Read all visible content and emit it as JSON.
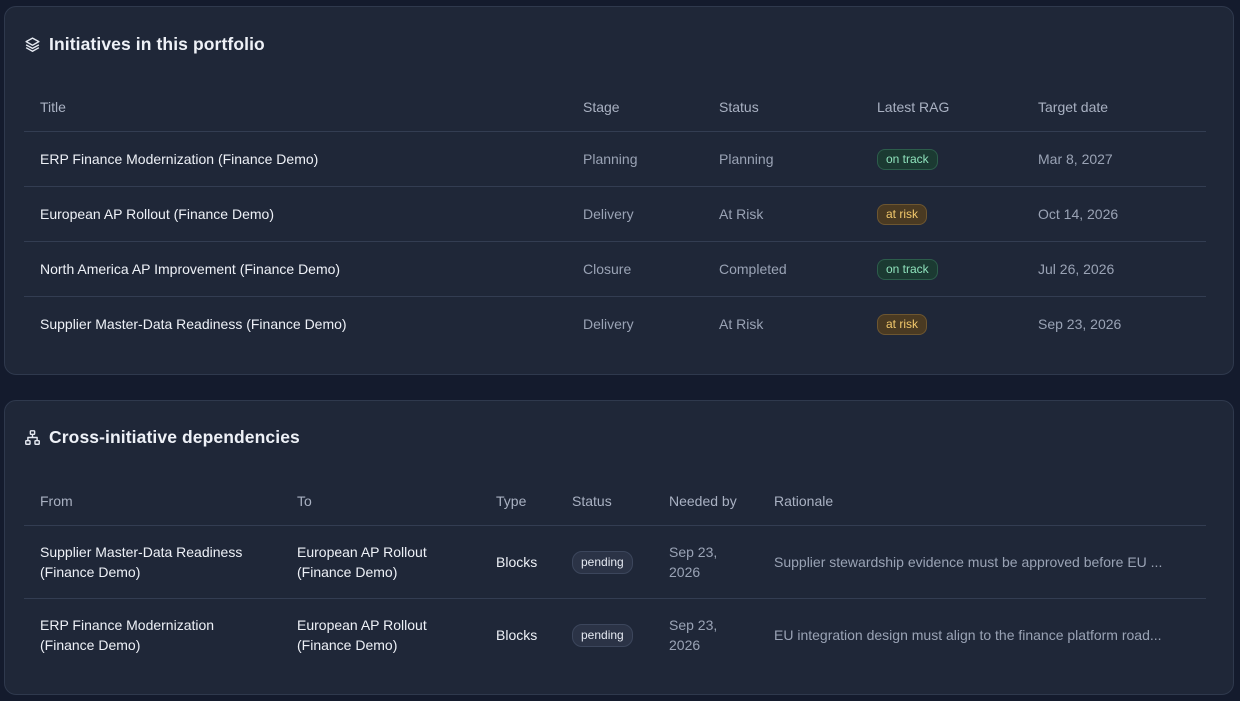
{
  "initiatives": {
    "title": "Initiatives in this portfolio",
    "icon": "layers-icon",
    "columns": [
      "Title",
      "Stage",
      "Status",
      "Latest RAG",
      "Target date"
    ],
    "rows": [
      {
        "title": "ERP Finance Modernization (Finance Demo)",
        "stage": "Planning",
        "status": "Planning",
        "rag": "on track",
        "target": "Mar 8, 2027"
      },
      {
        "title": "European AP Rollout (Finance Demo)",
        "stage": "Delivery",
        "status": "At Risk",
        "rag": "at risk",
        "target": "Oct 14, 2026"
      },
      {
        "title": "North America AP Improvement (Finance Demo)",
        "stage": "Closure",
        "status": "Completed",
        "rag": "on track",
        "target": "Jul 26, 2026"
      },
      {
        "title": "Supplier Master-Data Readiness (Finance Demo)",
        "stage": "Delivery",
        "status": "At Risk",
        "rag": "at risk",
        "target": "Sep 23, 2026"
      }
    ]
  },
  "dependencies": {
    "title": "Cross-initiative dependencies",
    "icon": "network-icon",
    "columns": [
      "From",
      "To",
      "Type",
      "Status",
      "Needed by",
      "Rationale"
    ],
    "rows": [
      {
        "from": "Supplier Master-Data Readiness (Finance Demo)",
        "to": "European AP Rollout (Finance Demo)",
        "type": "Blocks",
        "status": "pending",
        "needed_by": "Sep 23, 2026",
        "rationale": "Supplier stewardship evidence must be approved before EU ..."
      },
      {
        "from": "ERP Finance Modernization (Finance Demo)",
        "to": "European AP Rollout (Finance Demo)",
        "type": "Blocks",
        "status": "pending",
        "needed_by": "Sep 23, 2026",
        "rationale": "EU integration design must align to the finance platform road..."
      }
    ]
  },
  "colors": {
    "background": "#141b2d",
    "card": "#1f2738",
    "on_track": "#8fe3bc",
    "at_risk": "#f3c96c"
  }
}
